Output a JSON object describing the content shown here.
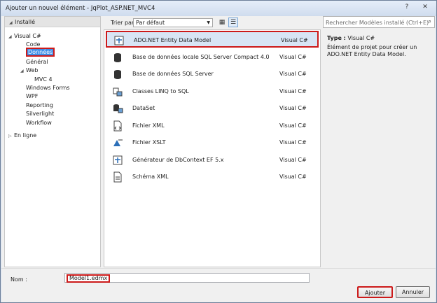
{
  "window": {
    "title": "Ajouter un nouvel élément - JqPlot_ASP.NET_MVC4",
    "help_glyph": "?",
    "close_glyph": "✕"
  },
  "left_panel": {
    "header": "Installé",
    "tree": [
      {
        "label": "Visual C#"
      },
      {
        "label": "Code"
      },
      {
        "label": "Données"
      },
      {
        "label": "Général"
      },
      {
        "label": "Web"
      },
      {
        "label": "MVC 4"
      },
      {
        "label": "Windows Forms"
      },
      {
        "label": "WPF"
      },
      {
        "label": "Reporting"
      },
      {
        "label": "Silverlight"
      },
      {
        "label": "Workflow"
      },
      {
        "label": "En ligne"
      }
    ]
  },
  "toolbar": {
    "sort_label": "Trier par:",
    "sort_value": "Par défaut"
  },
  "templates": [
    {
      "name": "ADO.NET Entity Data Model",
      "lang": "Visual C#",
      "icon": "entity-model-icon"
    },
    {
      "name": "Base de données locale SQL Server Compact 4.0",
      "lang": "Visual C#",
      "icon": "database-icon"
    },
    {
      "name": "Base de données SQL Server",
      "lang": "Visual C#",
      "icon": "database-icon"
    },
    {
      "name": "Classes LINQ to SQL",
      "lang": "Visual C#",
      "icon": "linq-icon"
    },
    {
      "name": "DataSet",
      "lang": "Visual C#",
      "icon": "dataset-icon"
    },
    {
      "name": "Fichier XML",
      "lang": "Visual C#",
      "icon": "xml-file-icon"
    },
    {
      "name": "Fichier XSLT",
      "lang": "Visual C#",
      "icon": "xslt-icon"
    },
    {
      "name": "Générateur de DbContext EF 5.x",
      "lang": "Visual C#",
      "icon": "generator-icon"
    },
    {
      "name": "Schéma XML",
      "lang": "Visual C#",
      "icon": "schema-icon"
    }
  ],
  "details": {
    "search_placeholder": "Rechercher Modèles installé (Ctrl+E)",
    "type_label": "Type :",
    "type_value": "Visual C#",
    "description": "Élément de projet pour créer un ADO.NET Entity Data Model."
  },
  "footer": {
    "name_label": "Nom :",
    "name_value": "Model1.edmx",
    "add_label": "Ajouter",
    "cancel_label": "Annuler"
  },
  "colors": {
    "highlight": "#cc1a1a",
    "selection": "#3d8ee8"
  }
}
